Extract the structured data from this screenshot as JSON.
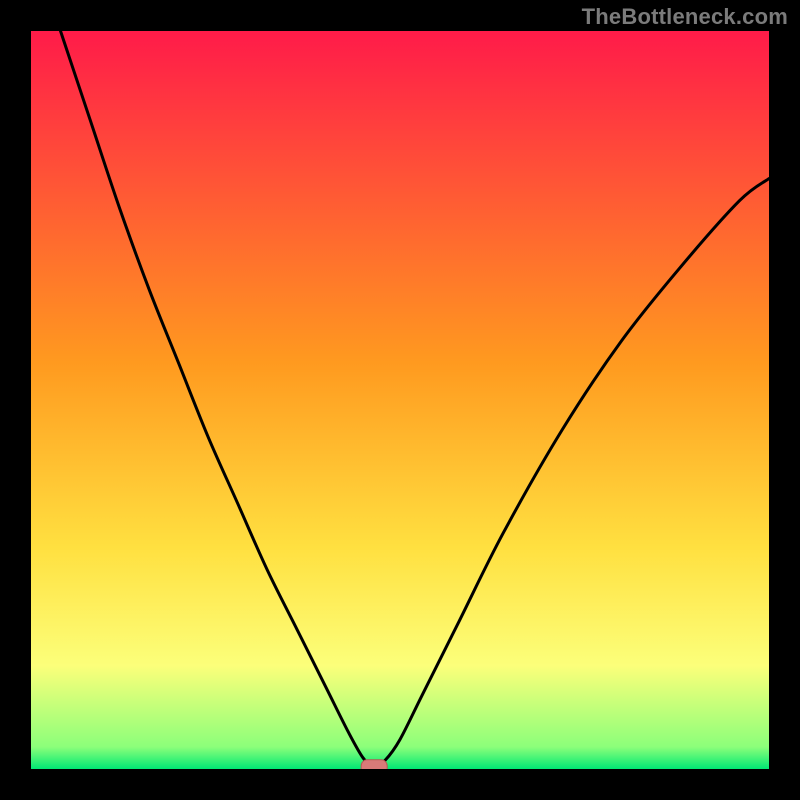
{
  "watermark": "TheBottleneck.com",
  "colors": {
    "top": "#ff1b49",
    "mid": "#ffc500",
    "lower": "#fcff7a",
    "bottom": "#00e874",
    "curve": "#000000",
    "marker_fill": "#d87a78",
    "marker_stroke": "#b85855",
    "frame": "#000000"
  },
  "chart_data": {
    "type": "line",
    "title": "",
    "xlabel": "",
    "ylabel": "",
    "xlim": [
      0,
      100
    ],
    "ylim": [
      0,
      100
    ],
    "grid": false,
    "legend": false,
    "series": [
      {
        "name": "bottleneck-curve",
        "x": [
          4,
          8,
          12,
          16,
          20,
          24,
          28,
          32,
          36,
          40,
          43,
          45,
          46.5,
          48,
          50,
          53,
          58,
          64,
          72,
          80,
          88,
          96,
          100
        ],
        "y": [
          100,
          88,
          76,
          65,
          55,
          45,
          36,
          27,
          19,
          11,
          5,
          1.5,
          0.3,
          1.2,
          4,
          10,
          20,
          32,
          46,
          58,
          68,
          77,
          80
        ]
      }
    ],
    "annotations": [
      {
        "name": "vertex-marker",
        "x": 46.5,
        "y": 0.3,
        "shape": "rounded-box"
      }
    ],
    "background": {
      "gradient_stops": [
        {
          "offset": 0.0,
          "color": "#ff1b49"
        },
        {
          "offset": 0.45,
          "color": "#ff9a1f"
        },
        {
          "offset": 0.7,
          "color": "#ffe040"
        },
        {
          "offset": 0.86,
          "color": "#fcff7a"
        },
        {
          "offset": 0.97,
          "color": "#8cff7a"
        },
        {
          "offset": 1.0,
          "color": "#00e874"
        }
      ]
    }
  }
}
